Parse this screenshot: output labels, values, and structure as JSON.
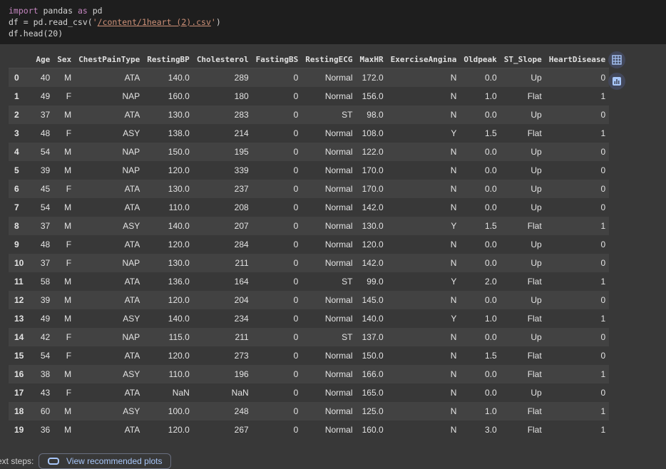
{
  "code": {
    "line1": {
      "kw1": "import",
      "mid": " pandas ",
      "kw2": "as",
      "end": " pd"
    },
    "line2": {
      "pre": "df = pd.read_csv(",
      "q1": "'",
      "path": "/content/1heart (2).csv",
      "q2": "'",
      "post": ")"
    },
    "line3": "df.head(20)"
  },
  "table": {
    "columns": [
      "",
      "Age",
      "Sex",
      "ChestPainType",
      "RestingBP",
      "Cholesterol",
      "FastingBS",
      "RestingECG",
      "MaxHR",
      "ExerciseAngina",
      "Oldpeak",
      "ST_Slope",
      "HeartDisease"
    ],
    "rows": [
      [
        "0",
        "40",
        "M",
        "ATA",
        "140.0",
        "289",
        "0",
        "Normal",
        "172.0",
        "N",
        "0.0",
        "Up",
        "0"
      ],
      [
        "1",
        "49",
        "F",
        "NAP",
        "160.0",
        "180",
        "0",
        "Normal",
        "156.0",
        "N",
        "1.0",
        "Flat",
        "1"
      ],
      [
        "2",
        "37",
        "M",
        "ATA",
        "130.0",
        "283",
        "0",
        "ST",
        "98.0",
        "N",
        "0.0",
        "Up",
        "0"
      ],
      [
        "3",
        "48",
        "F",
        "ASY",
        "138.0",
        "214",
        "0",
        "Normal",
        "108.0",
        "Y",
        "1.5",
        "Flat",
        "1"
      ],
      [
        "4",
        "54",
        "M",
        "NAP",
        "150.0",
        "195",
        "0",
        "Normal",
        "122.0",
        "N",
        "0.0",
        "Up",
        "0"
      ],
      [
        "5",
        "39",
        "M",
        "NAP",
        "120.0",
        "339",
        "0",
        "Normal",
        "170.0",
        "N",
        "0.0",
        "Up",
        "0"
      ],
      [
        "6",
        "45",
        "F",
        "ATA",
        "130.0",
        "237",
        "0",
        "Normal",
        "170.0",
        "N",
        "0.0",
        "Up",
        "0"
      ],
      [
        "7",
        "54",
        "M",
        "ATA",
        "110.0",
        "208",
        "0",
        "Normal",
        "142.0",
        "N",
        "0.0",
        "Up",
        "0"
      ],
      [
        "8",
        "37",
        "M",
        "ASY",
        "140.0",
        "207",
        "0",
        "Normal",
        "130.0",
        "Y",
        "1.5",
        "Flat",
        "1"
      ],
      [
        "9",
        "48",
        "F",
        "ATA",
        "120.0",
        "284",
        "0",
        "Normal",
        "120.0",
        "N",
        "0.0",
        "Up",
        "0"
      ],
      [
        "10",
        "37",
        "F",
        "NAP",
        "130.0",
        "211",
        "0",
        "Normal",
        "142.0",
        "N",
        "0.0",
        "Up",
        "0"
      ],
      [
        "11",
        "58",
        "M",
        "ATA",
        "136.0",
        "164",
        "0",
        "ST",
        "99.0",
        "Y",
        "2.0",
        "Flat",
        "1"
      ],
      [
        "12",
        "39",
        "M",
        "ATA",
        "120.0",
        "204",
        "0",
        "Normal",
        "145.0",
        "N",
        "0.0",
        "Up",
        "0"
      ],
      [
        "13",
        "49",
        "M",
        "ASY",
        "140.0",
        "234",
        "0",
        "Normal",
        "140.0",
        "Y",
        "1.0",
        "Flat",
        "1"
      ],
      [
        "14",
        "42",
        "F",
        "NAP",
        "115.0",
        "211",
        "0",
        "ST",
        "137.0",
        "N",
        "0.0",
        "Up",
        "0"
      ],
      [
        "15",
        "54",
        "F",
        "ATA",
        "120.0",
        "273",
        "0",
        "Normal",
        "150.0",
        "N",
        "1.5",
        "Flat",
        "0"
      ],
      [
        "16",
        "38",
        "M",
        "ASY",
        "110.0",
        "196",
        "0",
        "Normal",
        "166.0",
        "N",
        "0.0",
        "Flat",
        "1"
      ],
      [
        "17",
        "43",
        "F",
        "ATA",
        "NaN",
        "NaN",
        "0",
        "Normal",
        "165.0",
        "N",
        "0.0",
        "Up",
        "0"
      ],
      [
        "18",
        "60",
        "M",
        "ASY",
        "100.0",
        "248",
        "0",
        "Normal",
        "125.0",
        "N",
        "1.0",
        "Flat",
        "1"
      ],
      [
        "19",
        "36",
        "M",
        "ATA",
        "120.0",
        "267",
        "0",
        "Normal",
        "160.0",
        "N",
        "3.0",
        "Flat",
        "1"
      ]
    ]
  },
  "side_icons": [
    "table-icon",
    "chart-icon"
  ],
  "footer": {
    "label": "ext steps:",
    "button": "View recommended plots"
  },
  "colors": {
    "code_bg": "#1e1e1e",
    "output_bg": "#383838",
    "stripe": "#424242",
    "accent": "#a8c7fa"
  }
}
